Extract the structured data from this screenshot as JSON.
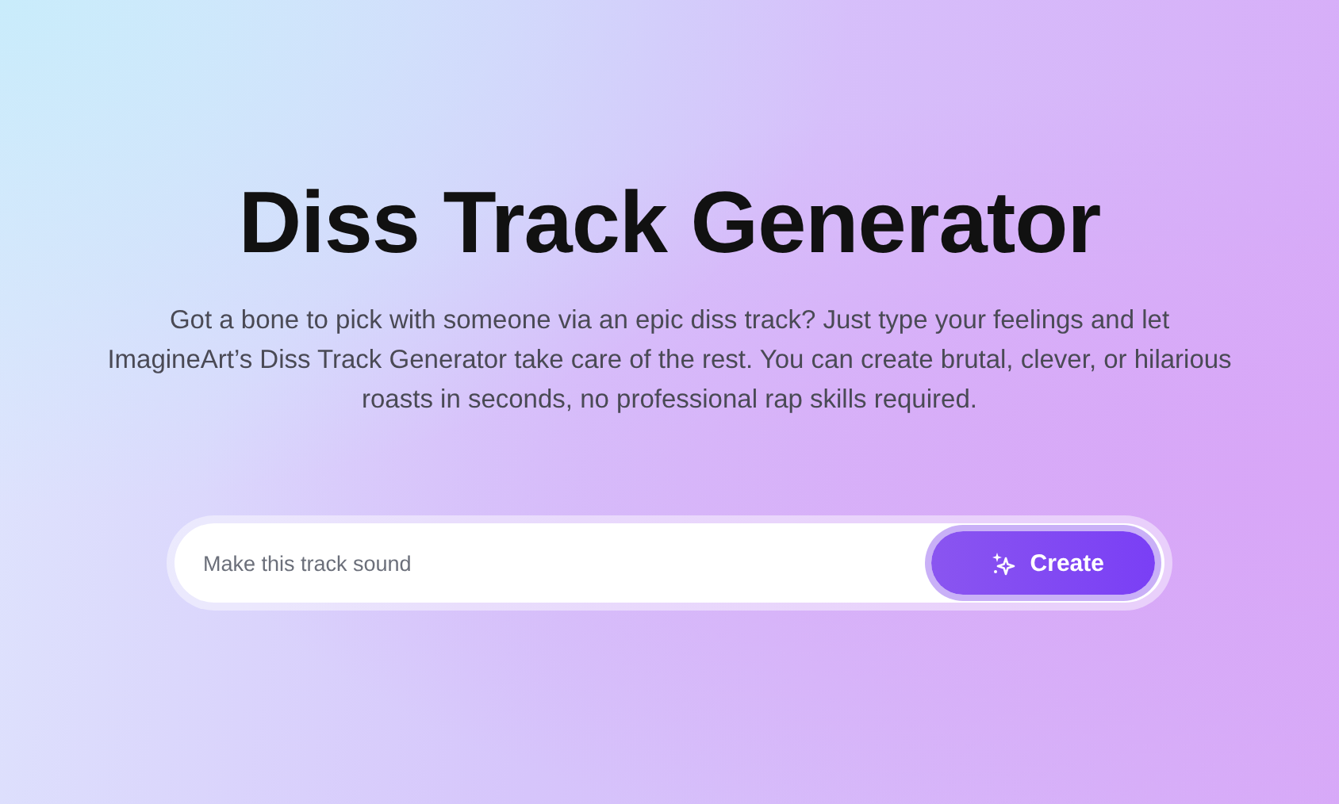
{
  "title": "Diss Track Generator",
  "description": "Got a bone to pick with someone via an epic diss track? Just type your feelings and let ImagineArt’s Diss Track Generator take care of the rest. You can create brutal, clever, or hilarious roasts in seconds, no professional rap skills required.",
  "prompt": {
    "placeholder": "Make this track sound"
  },
  "create_button": {
    "label": "Create"
  }
}
